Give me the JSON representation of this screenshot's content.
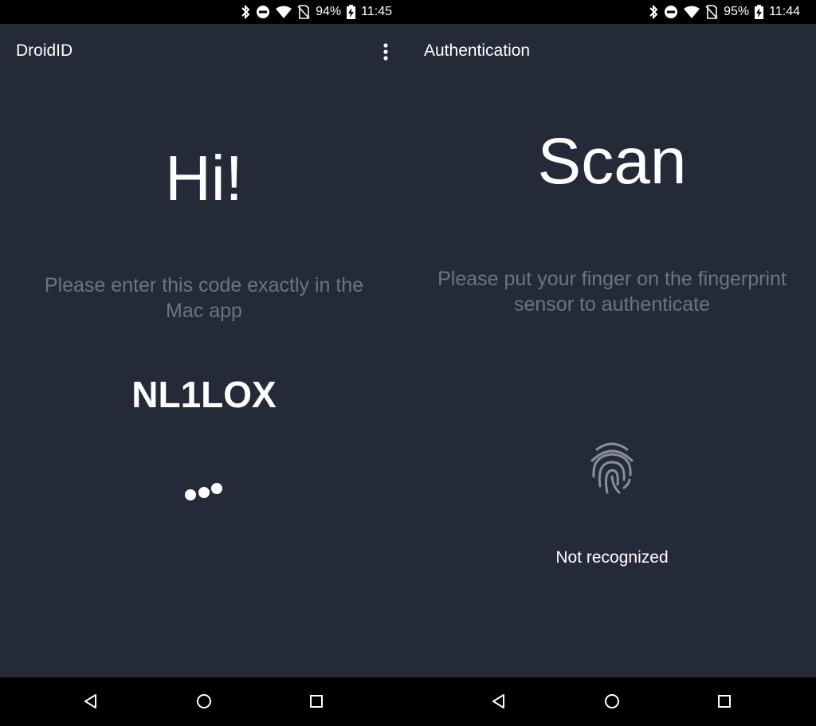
{
  "left": {
    "status": {
      "battery": "94%",
      "time": "11:45"
    },
    "app_title": "DroidID",
    "greeting": "Hi!",
    "instructions": "Please enter this code exactly in the Mac app",
    "code": "NL1LOX"
  },
  "right": {
    "status": {
      "battery": "95%",
      "time": "11:44"
    },
    "app_title": "Authentication",
    "title": "Scan",
    "instructions": "Please put your finger on the fingerprint sensor to authenticate",
    "message": "Not recognized"
  },
  "colors": {
    "background": "#252a38",
    "text_primary": "#ffffff",
    "text_secondary": "#6e7383",
    "bars": "#000000"
  },
  "icons": [
    "bluetooth-icon",
    "do-not-disturb-icon",
    "wifi-icon",
    "no-sim-icon",
    "battery-charging-icon",
    "more-vert-icon",
    "loading-dots-icon",
    "fingerprint-icon",
    "nav-back-icon",
    "nav-home-icon",
    "nav-recent-icon"
  ]
}
